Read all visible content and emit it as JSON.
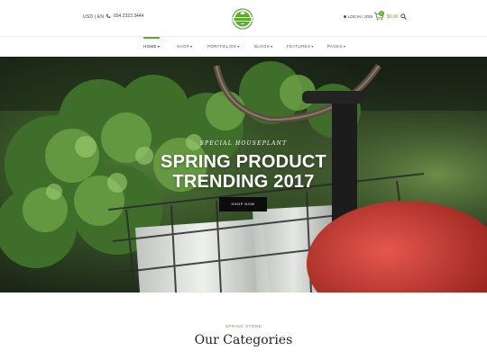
{
  "topbar": {
    "language": "USD | EN",
    "phone": "034 2323 3444",
    "login": "LOG IN / JOIN",
    "cart_count": "0",
    "cart_total": "$0.00"
  },
  "nav": {
    "items": [
      {
        "label": "HOME",
        "active": true
      },
      {
        "label": "SHOP"
      },
      {
        "label": "PORTFOLIOS"
      },
      {
        "label": "BLOGS"
      },
      {
        "label": "FEATURES"
      },
      {
        "label": "PAGES"
      }
    ]
  },
  "hero": {
    "subtitle": "SPECIAL HOUSEPLANT",
    "title_line1": "SPRING PRODUCT",
    "title_line2": "TRENDING 2017",
    "button_label": "SHOP NOW"
  },
  "categories": {
    "subtitle": "SPRING STORE",
    "title": "Our Categories"
  },
  "colors": {
    "accent": "#5fa832",
    "hero_button": "#0c0c0c"
  },
  "icons": {
    "phone": "phone-icon",
    "user": "user-icon",
    "cart": "cart-icon",
    "search": "search-icon",
    "logo": "logo-emblem"
  }
}
